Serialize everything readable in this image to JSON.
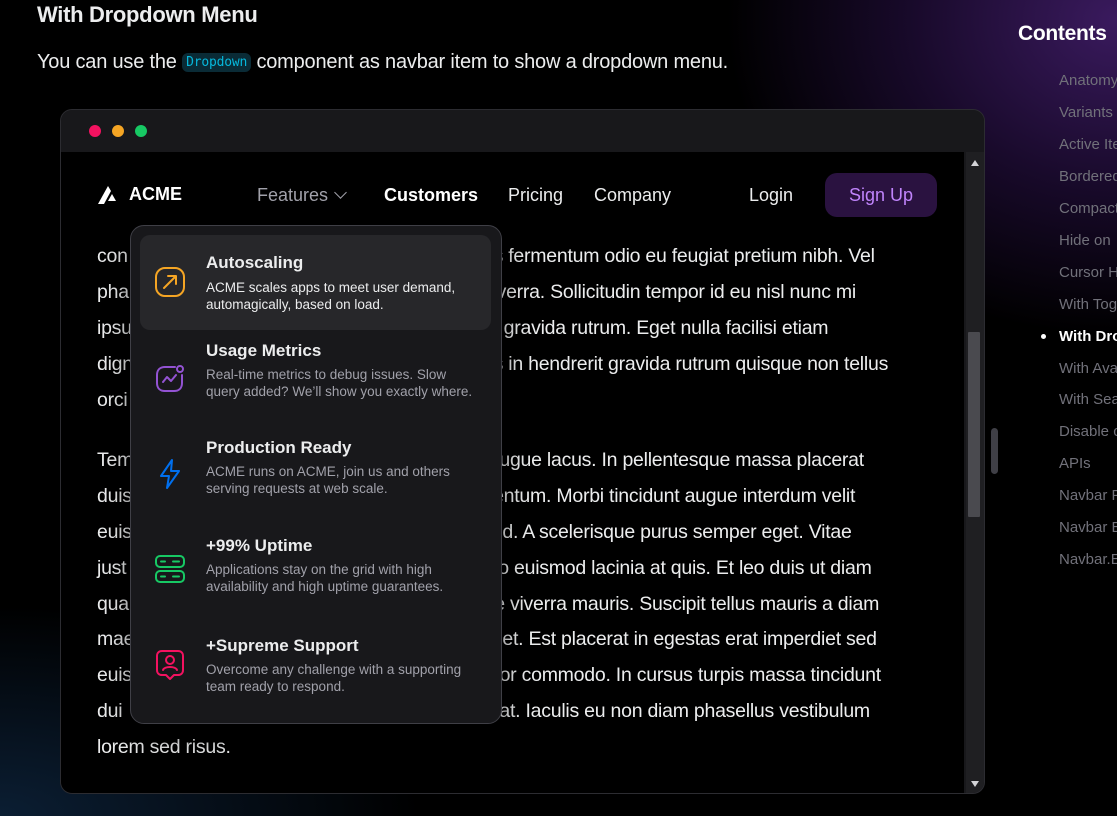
{
  "section": {
    "title": "With Dropdown Menu",
    "intro_before": "You can use the ",
    "intro_code": "Dropdown",
    "intro_after": " component as navbar item to show a dropdown menu."
  },
  "navbar": {
    "brand": "ACME",
    "links": [
      "Features",
      "Customers",
      "Pricing",
      "Company"
    ],
    "login": "Login",
    "signup": "Sign Up"
  },
  "dropdown": {
    "items": [
      {
        "title": "Autoscaling",
        "description": "ACME scales apps to meet user demand, automagically, based on load.",
        "icon": "autoscaling-icon",
        "color": "#F5A524"
      },
      {
        "title": "Usage Metrics",
        "description": "Real-time metrics to debug issues. Slow query added? We’ll show you exactly where.",
        "icon": "activity-icon",
        "color": "#9353D3"
      },
      {
        "title": "Production Ready",
        "description": "ACME runs on ACME, join us and others serving requests at web scale.",
        "icon": "flash-icon",
        "color": "#006FEE"
      },
      {
        "title": "+99% Uptime",
        "description": "Applications stay on the grid with high availability and high uptime guarantees.",
        "icon": "server-icon",
        "color": "#17C964"
      },
      {
        "title": "+Supreme Support",
        "description": "Overcome any challenge with a supporting team ready to respond.",
        "icon": "user-support-icon",
        "color": "#F31260"
      }
    ]
  },
  "content": {
    "lines1": [
      "con",
      "pha",
      "ipsu",
      "dign",
      "orci"
    ],
    "lines1_right": [
      "as fermentum odio eu feugiat pretium nibh. Vel",
      "viverra. Sollicitudin tempor id eu nisl nunc mi",
      "rit gravida rutrum. Eget nulla facilisi etiam",
      "us in hendrerit gravida rutrum quisque non tellus",
      ""
    ],
    "lines2": [
      "Tem",
      "duis",
      "euis",
      "just",
      "qua",
      "mae",
      "euis",
      "dui",
      "lorem sed risus."
    ],
    "lines2_right": [
      "d augue lacus. In pellentesque massa placerat",
      "imentum. Morbi tincidunt augue interdum velit",
      "nc id. A scelerisque purus semper eget. Vitae",
      "odio euismod lacinia at quis. Et leo duis ut diam",
      "que viverra mauris. Suscipit tellus mauris a diam",
      "liquet. Est placerat in egestas erat imperdiet sed",
      "mpor commodo. In cursus turpis massa tincidunt",
      "utpat. Iaculis eu non diam phasellus vestibulum",
      ""
    ]
  },
  "toc": {
    "title": "Contents",
    "items": [
      "Anatomy",
      "Variants",
      "Active Ite",
      "Bordered",
      "Compact",
      "Hide on",
      "Cursor H",
      "With Tog",
      "With Dro",
      "With Ava",
      "With Sea",
      "Disable c",
      "APIs",
      "Navbar P",
      "Navbar E",
      "Navbar.E"
    ],
    "current": "With Dro"
  }
}
